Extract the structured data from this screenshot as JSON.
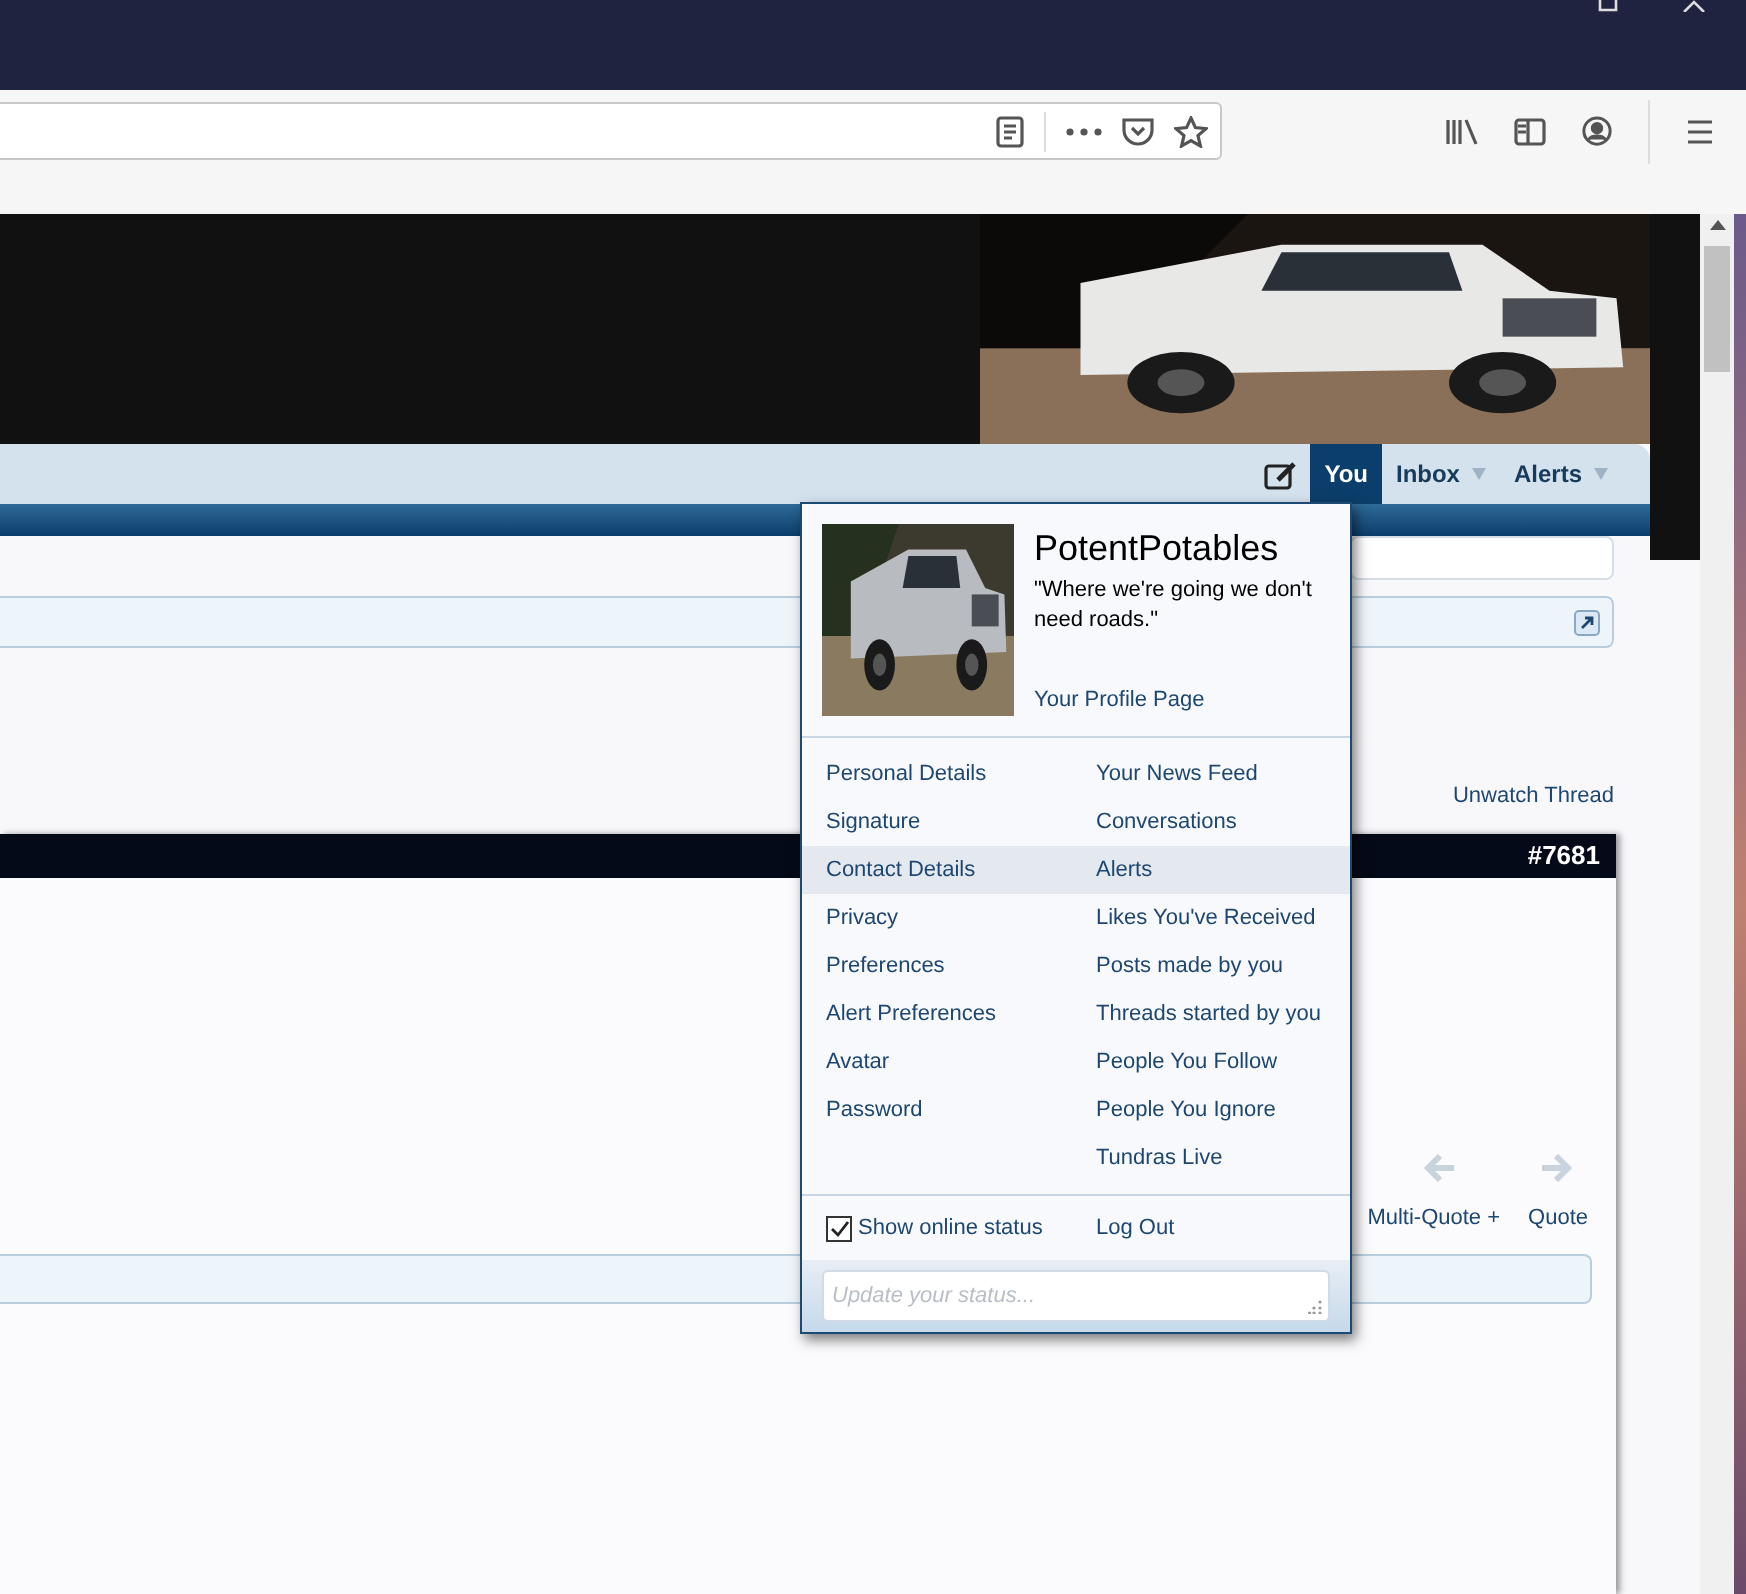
{
  "nav": {
    "tabs": [
      {
        "label": "You",
        "selected": true,
        "dropdown": false
      },
      {
        "label": "Inbox",
        "selected": false,
        "dropdown": true
      },
      {
        "label": "Alerts",
        "selected": false,
        "dropdown": true
      }
    ]
  },
  "thread": {
    "unwatch": "Unwatch Thread",
    "post_number": "#7681",
    "actions": [
      "Multi-Quote +",
      "Quote"
    ]
  },
  "menu": {
    "username": "PotentPotables",
    "status": "\"Where we're going we don't need roads.\"",
    "profile_link": "Your Profile Page",
    "left_links": [
      {
        "label": "Personal Details",
        "hovered": false
      },
      {
        "label": "Signature",
        "hovered": false
      },
      {
        "label": "Contact Details",
        "hovered": true
      },
      {
        "label": "Privacy",
        "hovered": false
      },
      {
        "label": "Preferences",
        "hovered": false
      },
      {
        "label": "Alert Preferences",
        "hovered": false
      },
      {
        "label": "Avatar",
        "hovered": false
      },
      {
        "label": "Password",
        "hovered": false
      }
    ],
    "right_links": [
      {
        "label": "Your News Feed",
        "hovered": false
      },
      {
        "label": "Conversations",
        "hovered": false
      },
      {
        "label": "Alerts",
        "hovered": true
      },
      {
        "label": "Likes You've Received",
        "hovered": false
      },
      {
        "label": "Posts made by you",
        "hovered": false
      },
      {
        "label": "Threads started by you",
        "hovered": false
      },
      {
        "label": "People You Follow",
        "hovered": false
      },
      {
        "label": "People You Ignore",
        "hovered": false
      },
      {
        "label": "Tundras Live",
        "hovered": false
      }
    ],
    "show_online": {
      "label": "Show online status",
      "checked": true
    },
    "logout": "Log Out",
    "status_field": {
      "placeholder": "Update your status..."
    }
  }
}
